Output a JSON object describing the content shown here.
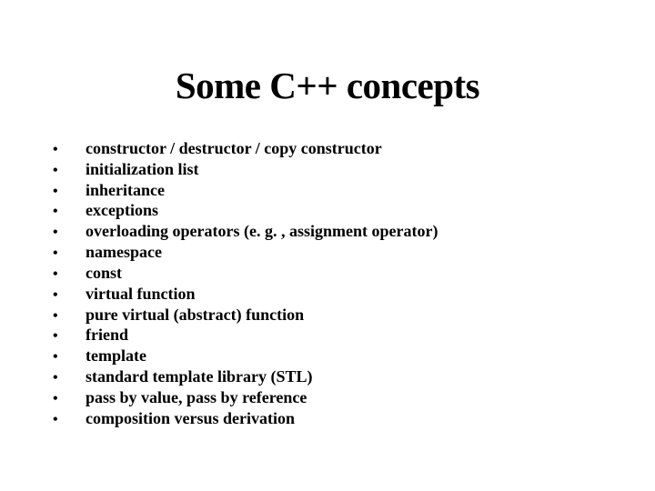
{
  "title": "Some C++ concepts",
  "items": [
    "constructor / destructor / copy constructor",
    "initialization list",
    "inheritance",
    "exceptions",
    "overloading operators (e. g. , assignment operator)",
    "namespace",
    "const",
    "virtual function",
    "pure virtual (abstract) function",
    "friend",
    "template",
    "standard template library (STL)",
    "pass by value, pass by reference",
    "composition versus derivation"
  ]
}
